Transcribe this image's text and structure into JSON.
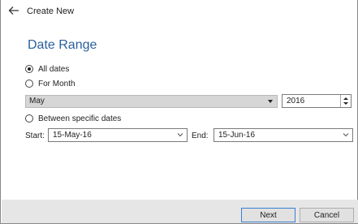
{
  "window": {
    "title": "Create New"
  },
  "page": {
    "heading": "Date Range"
  },
  "date_options": {
    "all_dates_label": "All dates",
    "all_dates_selected": true,
    "for_month_label": "For Month",
    "for_month_selected": false,
    "between_label": "Between specific dates",
    "between_selected": false
  },
  "month_picker": {
    "month_value": "May",
    "year_value": "2016"
  },
  "date_range": {
    "start_label": "Start:",
    "start_value": "15-May-16",
    "end_label": "End:",
    "end_value": "15-Jun-16"
  },
  "footer": {
    "next_label": "Next",
    "cancel_label": "Cancel"
  },
  "icons": {
    "back": "arrow-left-icon",
    "dropdown": "chevron-down-icon",
    "spin": "spin-arrows-icon"
  },
  "colors": {
    "heading": "#2a5f9e",
    "footer_bg": "#e6e6e6",
    "primary_border": "#3c7fd4"
  }
}
